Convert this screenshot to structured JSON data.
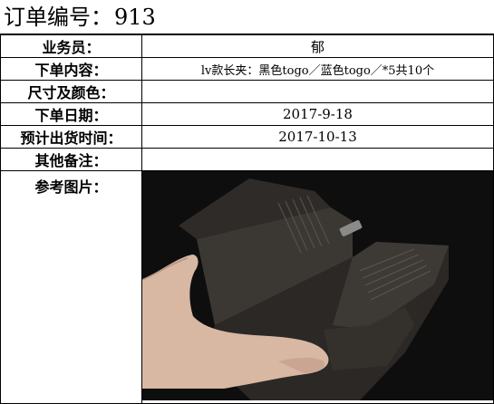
{
  "order": {
    "title_label": "订单编号：",
    "number": "913"
  },
  "fields": {
    "salesperson": {
      "label": "业务员：",
      "value": "郁"
    },
    "content": {
      "label": "下单内容：",
      "value": "lv款长夹：黑色togo／蓝色togo／*5共10个"
    },
    "size_color": {
      "label": "尺寸及颜色：",
      "value": ""
    },
    "order_date": {
      "label": "下单日期：",
      "value": "2017-9-18"
    },
    "ship_date": {
      "label": "预计出货时间：",
      "value": "2017-10-13"
    },
    "notes": {
      "label": "其他备注：",
      "value": ""
    },
    "photo": {
      "label": "参考图片："
    }
  },
  "photo_colors": {
    "background": "#0e0e0e",
    "leather": "#3a3632",
    "leather_dark": "#2a2724",
    "skin": "#d9b8a4"
  }
}
